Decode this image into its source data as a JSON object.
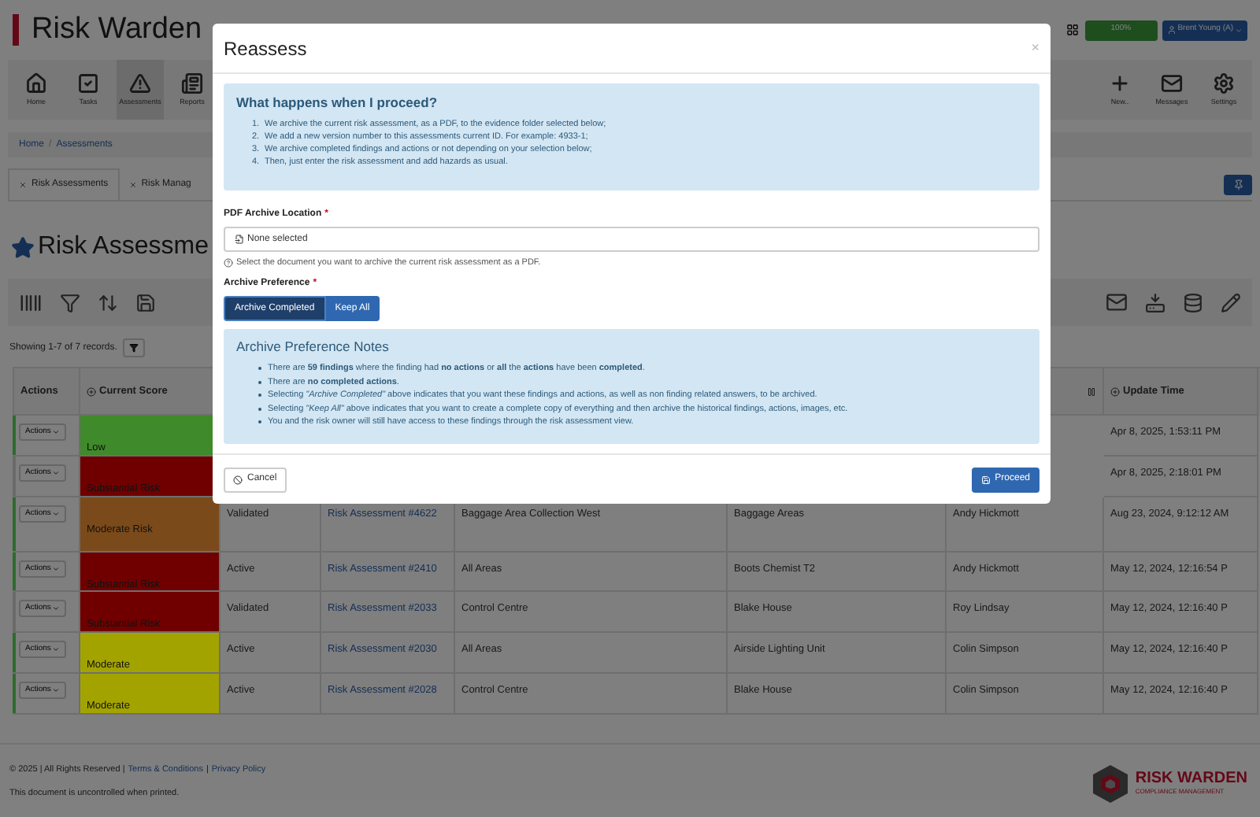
{
  "header": {
    "brand": "Risk Warden",
    "progress": "100%",
    "user": "Brent Young (A)"
  },
  "nav": {
    "left": [
      {
        "label": "Home",
        "selected": false
      },
      {
        "label": "Tasks",
        "selected": false
      },
      {
        "label": "Assessments",
        "selected": true
      },
      {
        "label": "Reports",
        "selected": false
      }
    ],
    "right": [
      {
        "label": "New..",
        "selected": false
      },
      {
        "label": "Messages",
        "selected": false
      },
      {
        "label": "Settings",
        "selected": false
      }
    ]
  },
  "breadcrumb": {
    "items": [
      "Home",
      "Assessments"
    ],
    "separator": "/"
  },
  "tabs": [
    {
      "label": "Risk Assessments",
      "selected": true
    },
    {
      "label": "Risk Manag",
      "selected": false
    }
  ],
  "page_title": "Risk Assessme",
  "records": "Showing 1-7 of 7 records.",
  "table": {
    "columns": {
      "actions": "Actions",
      "current_score": "Current Score",
      "update_time": "Update Time"
    },
    "rows": [
      {
        "action": "Actions",
        "score": "Low",
        "color": "#3f8a2a",
        "updated": "Apr 8, 2025, 1:53:11 PM",
        "flagged": true
      },
      {
        "action": "Actions",
        "score": "Substantial Risk",
        "color": "#700000",
        "updated": "Apr 8, 2025, 2:18:01 PM",
        "flagged": false
      },
      {
        "action": "Actions",
        "score": "Moderate Risk",
        "color": "#7b4a1a",
        "status": "Validated",
        "assessment": "Risk Assessment #4622",
        "area": "Baggage Area Collection West",
        "site": "Baggage Areas",
        "owner": "Andy Hickmott",
        "updated": "Aug 23, 2024, 9:12:12 AM",
        "flagged": true
      },
      {
        "action": "Actions",
        "score": "Substantial Risk",
        "color": "#700000",
        "status": "Active",
        "assessment": "Risk Assessment #2410",
        "area": "All Areas",
        "site": "Boots Chemist T2",
        "owner": "Andy Hickmott",
        "updated": "May 12, 2024, 12:16:54 P",
        "flagged": true
      },
      {
        "action": "Actions",
        "score": "Substantial Risk",
        "color": "#700000",
        "status": "Validated",
        "assessment": "Risk Assessment #2033",
        "area": "Control Centre",
        "site": "Blake House",
        "owner": "Roy Lindsay",
        "updated": "May 12, 2024, 12:16:40 P",
        "flagged": false
      },
      {
        "action": "Actions",
        "score": "Moderate",
        "color": "#a3a300",
        "status": "Active",
        "assessment": "Risk Assessment #2030",
        "area": "All Areas",
        "site": "Airside Lighting Unit",
        "owner": "Colin Simpson",
        "updated": "May 12, 2024, 12:16:40 P",
        "flagged": true
      },
      {
        "action": "Actions",
        "score": "Moderate",
        "color": "#a3a300",
        "status": "Active",
        "assessment": "Risk Assessment #2028",
        "area": "Control Centre",
        "site": "Blake House",
        "owner": "Colin Simpson",
        "updated": "May 12, 2024, 12:16:40 P",
        "flagged": true
      }
    ]
  },
  "footer": {
    "copyright": "© 2025 | All Rights Reserved |",
    "terms": "Terms & Conditions",
    "separator": "|",
    "privacy": "Privacy Policy",
    "note": "This document is uncontrolled when printed.",
    "logo_name": "RISK WARDEN",
    "logo_tagline": "COMPLIANCE MANAGEMENT"
  },
  "modal": {
    "title": "Reassess",
    "close": "×",
    "info_title": "What happens when I proceed?",
    "steps": [
      {
        "number": "1.",
        "text": "We archive the current risk assessment, as a PDF, to the evidence folder selected below;"
      },
      {
        "number": "2.",
        "text": "We add a new version number to this assessments current ID. For example: 4933-1;"
      },
      {
        "number": "3.",
        "text": "We archive completed findings and actions or not depending on your selection below;"
      },
      {
        "number": "4.",
        "text": "Then, just enter the risk assessment and add hazards as usual."
      }
    ],
    "location_label": "PDF Archive Location",
    "required": "*",
    "location_value": "None selected",
    "location_help": "Select the document you want to archive the current risk assessment as a PDF.",
    "preference_label": "Archive Preference",
    "options": [
      {
        "label": "Archive Completed",
        "selected": true
      },
      {
        "label": "Keep All",
        "selected": false
      }
    ],
    "notes_title": "Archive Preference Notes",
    "notes": [
      "There are **59 findings** where the finding had **no actions** or **all** the **actions** have been **completed**.",
      "There are **no completed actions**.",
      "Selecting *\"Archive Completed\"* above indicates that you want these findings and actions, as well as non finding related answers, to be archived.",
      "Selecting *\"Keep All\"* above indicates that you want to create a complete copy of everything and then archive the historical findings, actions, images, etc.",
      "You and the risk owner will still have access to these findings through the risk assessment view."
    ],
    "cancel": "Cancel",
    "proceed": "Proceed"
  }
}
